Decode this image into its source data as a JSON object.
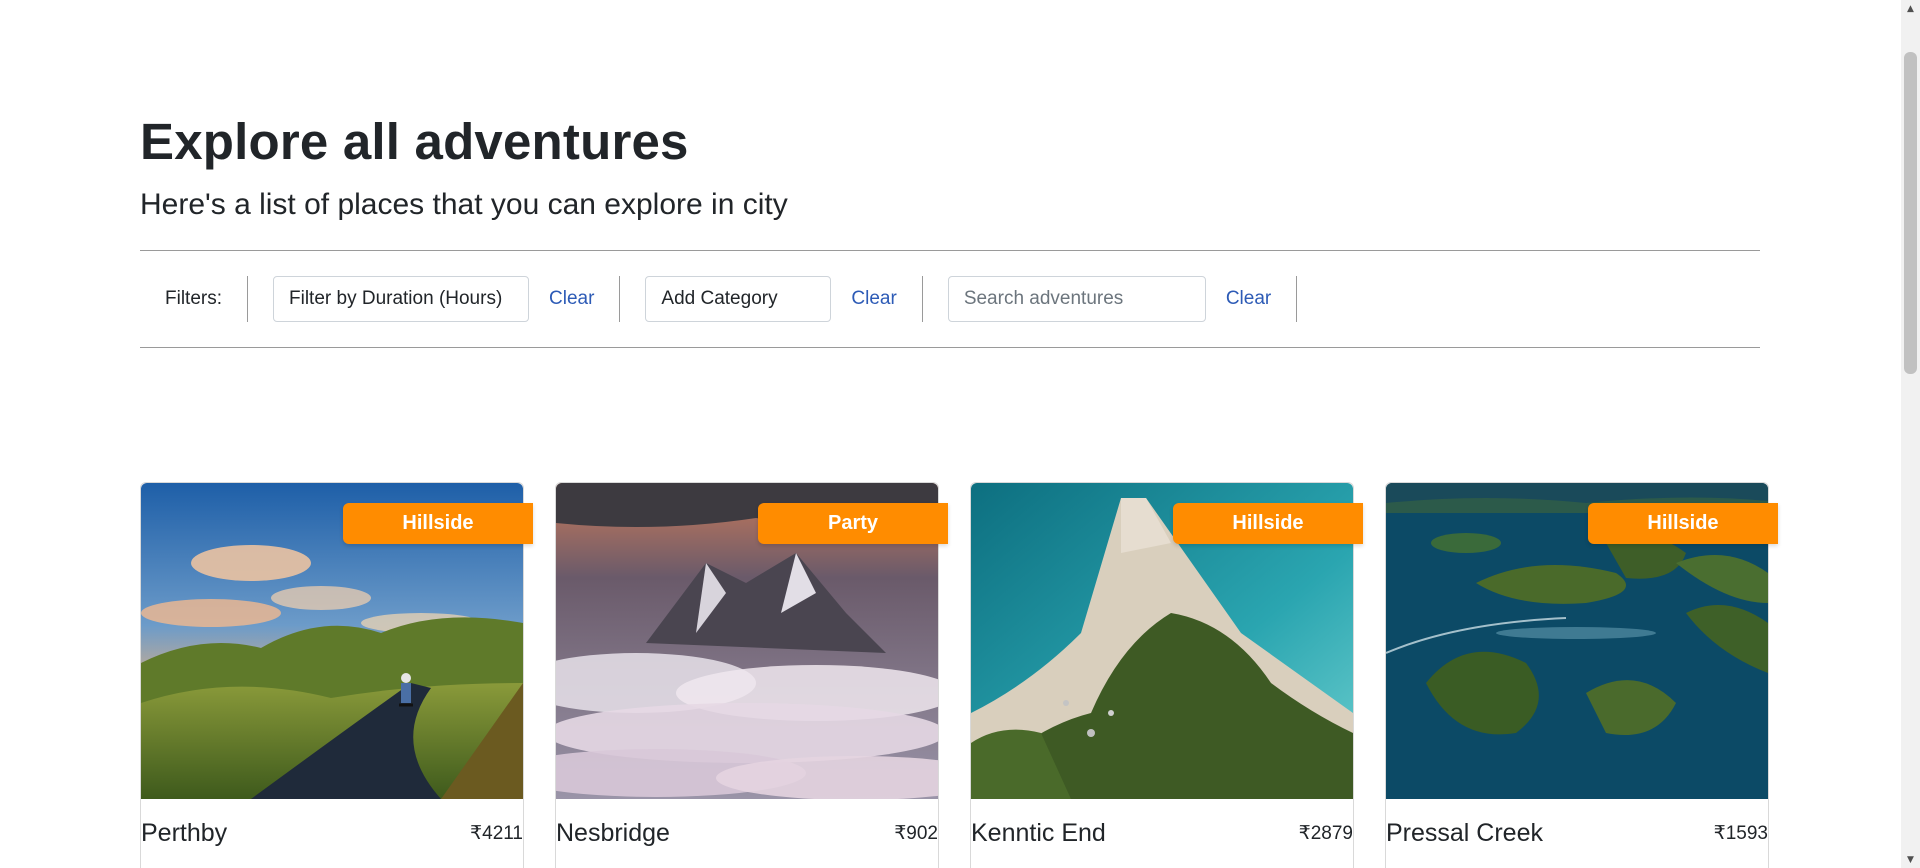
{
  "header": {
    "title": "Explore all adventures",
    "subtitle": "Here's a list of places that you can explore in city"
  },
  "filters": {
    "label": "Filters:",
    "duration_select": "Filter by Duration (Hours)",
    "category_select": "Add Category",
    "search_placeholder": "Search adventures",
    "clear_label": "Clear"
  },
  "colors": {
    "badge": "#ff8c00",
    "link": "#2d5bb6"
  },
  "adventures": [
    {
      "name": "Perthby",
      "price": "₹4211",
      "category": "Hillside"
    },
    {
      "name": "Nesbridge",
      "price": "₹902",
      "category": "Party"
    },
    {
      "name": "Kenntic End",
      "price": "₹2879",
      "category": "Hillside"
    },
    {
      "name": "Pressal Creek",
      "price": "₹1593",
      "category": "Hillside"
    }
  ]
}
